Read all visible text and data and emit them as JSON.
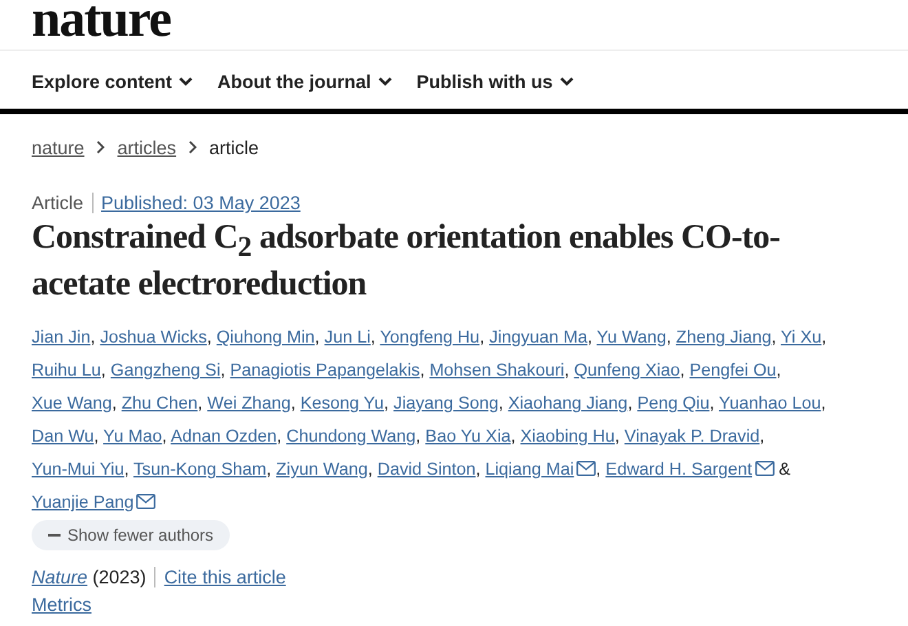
{
  "logo": "nature",
  "nav": [
    {
      "label": "Explore content"
    },
    {
      "label": "About the journal"
    },
    {
      "label": "Publish with us"
    }
  ],
  "breadcrumbs": [
    {
      "label": "nature",
      "link": true
    },
    {
      "label": "articles",
      "link": true
    },
    {
      "label": "article",
      "link": false
    }
  ],
  "article_type": "Article",
  "published": "Published: 03 May 2023",
  "title": "Constrained C$_{2}$ adsorbate orientation enables CO-to-acetate electroreduction",
  "authors": [
    {
      "name": "Jian Jin",
      "email": false,
      "separator": ","
    },
    {
      "name": "Joshua Wicks",
      "email": false,
      "separator": ","
    },
    {
      "name": "Qiuhong Min",
      "email": false,
      "separator": ","
    },
    {
      "name": "Jun Li",
      "email": false,
      "separator": ","
    },
    {
      "name": "Yongfeng Hu",
      "email": false,
      "separator": ","
    },
    {
      "name": "Jingyuan Ma",
      "email": false,
      "separator": ","
    },
    {
      "name": "Yu Wang",
      "email": false,
      "separator": ","
    },
    {
      "name": "Zheng Jiang",
      "email": false,
      "separator": ","
    },
    {
      "name": "Yi Xu",
      "email": false,
      "separator": ","
    },
    {
      "name": "Ruihu Lu",
      "email": false,
      "separator": ","
    },
    {
      "name": "Gangzheng Si",
      "email": false,
      "separator": ","
    },
    {
      "name": "Panagiotis Papangelakis",
      "email": false,
      "separator": ","
    },
    {
      "name": "Mohsen Shakouri",
      "email": false,
      "separator": ","
    },
    {
      "name": "Qunfeng Xiao",
      "email": false,
      "separator": ","
    },
    {
      "name": "Pengfei Ou",
      "email": false,
      "separator": ","
    },
    {
      "name": "Xue Wang",
      "email": false,
      "separator": ","
    },
    {
      "name": "Zhu Chen",
      "email": false,
      "separator": ","
    },
    {
      "name": "Wei Zhang",
      "email": false,
      "separator": ","
    },
    {
      "name": "Kesong Yu",
      "email": false,
      "separator": ","
    },
    {
      "name": "Jiayang Song",
      "email": false,
      "separator": ","
    },
    {
      "name": "Xiaohang Jiang",
      "email": false,
      "separator": ","
    },
    {
      "name": "Peng Qiu",
      "email": false,
      "separator": ","
    },
    {
      "name": "Yuanhao Lou",
      "email": false,
      "separator": ","
    },
    {
      "name": "Dan Wu",
      "email": false,
      "separator": ","
    },
    {
      "name": "Yu Mao",
      "email": false,
      "separator": ","
    },
    {
      "name": "Adnan Ozden",
      "email": false,
      "separator": ","
    },
    {
      "name": "Chundong Wang",
      "email": false,
      "separator": ","
    },
    {
      "name": "Bao Yu Xia",
      "email": false,
      "separator": ","
    },
    {
      "name": "Xiaobing Hu",
      "email": false,
      "separator": ","
    },
    {
      "name": "Vinayak P. Dravid",
      "email": false,
      "separator": ","
    },
    {
      "name": "Yun-Mui Yiu",
      "email": false,
      "separator": ","
    },
    {
      "name": "Tsun-Kong Sham",
      "email": false,
      "separator": ","
    },
    {
      "name": "Ziyun Wang",
      "email": false,
      "separator": ","
    },
    {
      "name": "David Sinton",
      "email": false,
      "separator": ","
    },
    {
      "name": "Liqiang Mai",
      "email": true,
      "separator": ","
    },
    {
      "name": "Edward H. Sargent",
      "email": true,
      "separator": "&"
    },
    {
      "name": "Yuanjie Pang",
      "email": true
    }
  ],
  "toggle_authors": "Show fewer authors",
  "journal": "Nature",
  "year": "(2023)",
  "cite": "Cite this article",
  "metrics": "Metrics"
}
